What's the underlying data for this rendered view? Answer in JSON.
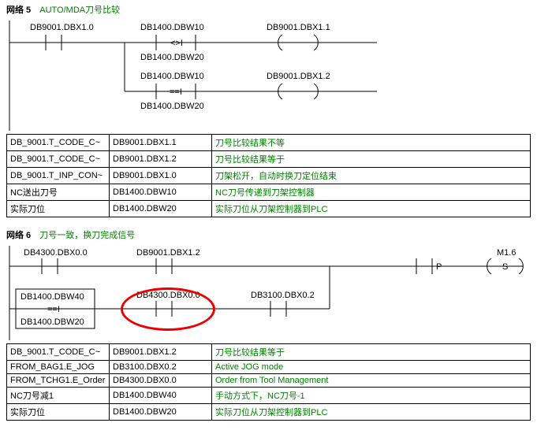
{
  "network5": {
    "number": "网络 5",
    "title": "AUTO/MDA刀号比较",
    "contacts": {
      "c1": "DB9001.DBX1.0",
      "cmp1_top": "DB1400.DBW10",
      "cmp1_op": "<>I",
      "cmp1_bot": "DB1400.DBW20",
      "cmp2_top": "DB1400.DBW10",
      "cmp2_op": "==I",
      "cmp2_bot": "DB1400.DBW20",
      "coil1": "DB9001.DBX1.1",
      "coil2": "DB9001.DBX1.2"
    },
    "table": [
      [
        "DB_9001.T_CODE_C~",
        "DB9001.DBX1.1",
        "刀号比较结果不等"
      ],
      [
        "DB_9001.T_CODE_C~",
        "DB9001.DBX1.2",
        "刀号比较结果等于"
      ],
      [
        "DB_9001.T_INP_CON~",
        "DB9001.DBX1.0",
        "刀架松开，自动时换刀定位结束"
      ],
      [
        "NC送出刀号",
        "DB1400.DBW10",
        "NC刀号传递到刀架控制器"
      ],
      [
        "实际刀位",
        "DB1400.DBW20",
        "实际刀位从刀架控制器到PLC"
      ]
    ]
  },
  "network6": {
    "number": "网络 6",
    "title": "刀号一致，换刀完成信号",
    "contacts": {
      "c1": "DB4300.DBX0.0",
      "c2": "DB9001.DBX1.2",
      "cmp_top": "DB1400.DBW40",
      "cmp_op": "==I",
      "cmp_bot": "DB1400.DBW20",
      "c3": "DB4300.DBX0.0",
      "c4": "DB3100.DBX0.2",
      "p": "P",
      "coil": "M1.6",
      "s": "S"
    },
    "table": [
      [
        "DB_9001.T_CODE_C~",
        "DB9001.DBX1.2",
        "刀号比较结果等于"
      ],
      [
        "FROM_BAG1.E_JOG",
        "DB3100.DBX0.2",
        "Active JOG mode"
      ],
      [
        "FROM_TCHG1.E_Order",
        "DB4300.DBX0.0",
        "Order from Tool Management"
      ],
      [
        "NC刀号减1",
        "DB1400.DBW40",
        "手动方式下，NC刀号-1"
      ],
      [
        "实际刀位",
        "DB1400.DBW20",
        "实际刀位从刀架控制器到PLC"
      ]
    ]
  }
}
